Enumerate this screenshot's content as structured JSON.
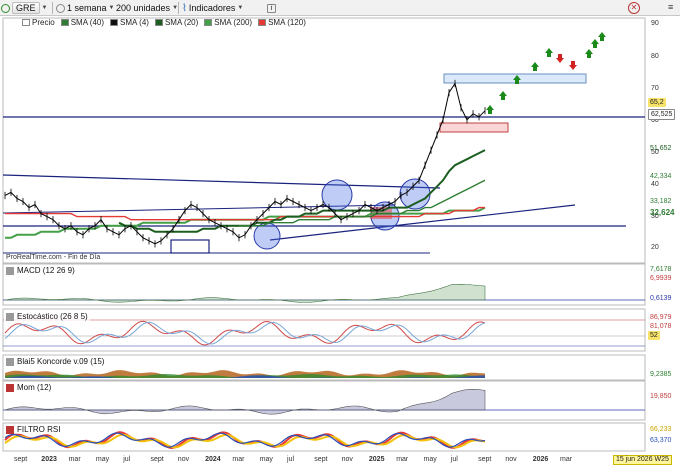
{
  "toolbar": {
    "ticker": "GRE",
    "interval": "1 semana",
    "units": "200 unidades",
    "indicators": "Indicadores",
    "info_icon": "info-icon"
  },
  "legend": {
    "price": "Precio",
    "items": [
      {
        "label": "SMA (40)",
        "color": "#2e7d32"
      },
      {
        "label": "SMA (4)",
        "color": "#111111"
      },
      {
        "label": "SMA (20)",
        "color": "#1b5e20"
      },
      {
        "label": "SMA (200)",
        "color": "#43a047"
      },
      {
        "label": "SMA (120)",
        "color": "#e53935"
      }
    ]
  },
  "price_axis": {
    "ticks": [
      "90",
      "80",
      "70",
      "60",
      "50",
      "40",
      "30",
      "20"
    ],
    "badges": [
      {
        "text": "65,2",
        "bg": "#f7e36a",
        "fg": "#000"
      },
      {
        "text": "62,525",
        "bg": "#ffffff",
        "fg": "#000"
      },
      {
        "text": "51,652",
        "bg": "#ffffff",
        "fg": "#1b5e20"
      },
      {
        "text": "42,334",
        "bg": "#ffffff",
        "fg": "#2e7d32"
      },
      {
        "text": "33,182",
        "bg": "#ffffff",
        "fg": "#2e7d32"
      },
      {
        "text": "32,624",
        "bg": "#ffffff",
        "fg": "#2e7d32"
      }
    ]
  },
  "credit": "ProRealTime.com - Fin de Día",
  "panes": {
    "macd": {
      "label": "MACD (12 26 9)",
      "badges": [
        "7,6178",
        "6,9939",
        "0,6139"
      ]
    },
    "stoch": {
      "label": "Estocástico (26 8 5)",
      "badges": [
        "86,979",
        "81,078",
        "52"
      ]
    },
    "koncorde": {
      "label": "Blai5 Koncorde v.09 (15)",
      "badges": [
        "9,2385"
      ]
    },
    "mom": {
      "label": "Mom (12)",
      "badges": [
        "19,850"
      ]
    },
    "rsi": {
      "label": "FILTRO RSI",
      "badges": [
        "66,233",
        "63,370"
      ]
    }
  },
  "x_axis": [
    "sept",
    "2023",
    "mar",
    "may",
    "jul",
    "sept",
    "nov",
    "2024",
    "mar",
    "may",
    "jul",
    "sept",
    "nov",
    "2025",
    "mar",
    "may",
    "jul",
    "sept",
    "nov",
    "2026",
    "mar"
  ],
  "date_badge": "15 jun 2026 W25",
  "chart_data": {
    "type": "line",
    "ticker": "GRE",
    "interval": "1 semana",
    "y_range": [
      15,
      95
    ],
    "price_levels": {
      "last": 65.2,
      "reference": 62.525,
      "sma20": 51.652,
      "sma40": 42.334,
      "sma120": 33.182,
      "sma200": 32.624
    },
    "series": [
      {
        "name": "Precio",
        "color": "#000000",
        "values": [
          37,
          38,
          36,
          35,
          33,
          34,
          31,
          30,
          29,
          27,
          26,
          27,
          25,
          24,
          26,
          27,
          29,
          26,
          25,
          24,
          26,
          27,
          25,
          23,
          22,
          21,
          22,
          24,
          26,
          29,
          32,
          34,
          33,
          31,
          29,
          28,
          27,
          26,
          25,
          23,
          24,
          27,
          29,
          31,
          33,
          35,
          34,
          36,
          35,
          34,
          33,
          32,
          33,
          34,
          33,
          31,
          29,
          30,
          31,
          32,
          34,
          33,
          32,
          33,
          34,
          35,
          37,
          38,
          40,
          42,
          47,
          52,
          57,
          62,
          71,
          74,
          66,
          62,
          64,
          63,
          65
        ]
      },
      {
        "name": "SMA (120)",
        "color": "#e53935",
        "values": [
          31,
          31,
          31,
          31,
          31,
          31,
          31,
          31,
          31,
          31,
          31,
          31,
          30,
          30,
          30,
          30,
          30,
          30,
          30,
          30,
          30,
          29,
          29,
          29,
          29,
          29,
          29,
          29,
          29,
          29,
          29,
          29,
          29,
          29,
          29,
          29,
          29,
          29,
          29,
          29,
          29,
          29,
          29,
          29,
          29,
          29,
          30,
          30,
          30,
          30,
          30,
          30,
          30,
          30,
          30,
          30,
          30,
          30,
          30,
          30,
          30,
          30,
          30,
          30,
          30,
          30,
          30,
          30,
          30,
          30,
          31,
          31,
          31,
          31,
          31,
          32,
          32,
          32,
          32,
          33,
          33
        ]
      },
      {
        "name": "SMA (200)",
        "color": "#43a047",
        "values": [
          23,
          23,
          24,
          24,
          24,
          24,
          25,
          25,
          25,
          25,
          26,
          26,
          26,
          26,
          26,
          26,
          27,
          27,
          27,
          27,
          27,
          27,
          27,
          28,
          28,
          28,
          28,
          28,
          28,
          28,
          28,
          29,
          29,
          29,
          29,
          29,
          29,
          29,
          29,
          29,
          29,
          29,
          29,
          29,
          30,
          30,
          30,
          30,
          30,
          30,
          30,
          30,
          30,
          30,
          30,
          30,
          30,
          30,
          30,
          30,
          30,
          31,
          31,
          31,
          31,
          31,
          31,
          31,
          31,
          31,
          31,
          31,
          31,
          31,
          32,
          32,
          32,
          32,
          32,
          32,
          33
        ]
      },
      {
        "name": "SMA (20)",
        "color": "#1b5e20",
        "values": [
          null,
          null,
          null,
          null,
          null,
          null,
          null,
          null,
          null,
          null,
          null,
          null,
          null,
          null,
          null,
          null,
          null,
          null,
          null,
          28,
          27,
          27,
          26,
          26,
          26,
          25,
          25,
          25,
          25,
          25,
          25,
          25,
          25,
          26,
          26,
          26,
          27,
          27,
          27,
          27,
          27,
          27,
          28,
          28,
          28,
          29,
          29,
          30,
          30,
          30,
          31,
          31,
          31,
          32,
          32,
          32,
          32,
          32,
          32,
          32,
          32,
          32,
          32,
          32,
          33,
          33,
          33,
          33,
          34,
          35,
          36,
          38,
          40,
          42,
          45,
          47,
          48,
          49,
          50,
          51,
          52
        ]
      },
      {
        "name": "SMA (40)",
        "color": "#2e7d32",
        "values": [
          null,
          null,
          null,
          null,
          null,
          null,
          null,
          null,
          null,
          null,
          null,
          null,
          null,
          null,
          null,
          null,
          null,
          null,
          null,
          null,
          null,
          null,
          null,
          null,
          null,
          null,
          null,
          null,
          null,
          null,
          null,
          null,
          null,
          null,
          null,
          null,
          null,
          null,
          null,
          27,
          27,
          27,
          27,
          27,
          28,
          28,
          28,
          28,
          28,
          29,
          29,
          29,
          29,
          29,
          29,
          30,
          30,
          30,
          30,
          30,
          30,
          30,
          31,
          31,
          31,
          31,
          31,
          32,
          32,
          32,
          33,
          33,
          34,
          35,
          36,
          37,
          38,
          39,
          40,
          41,
          42
        ]
      }
    ]
  }
}
